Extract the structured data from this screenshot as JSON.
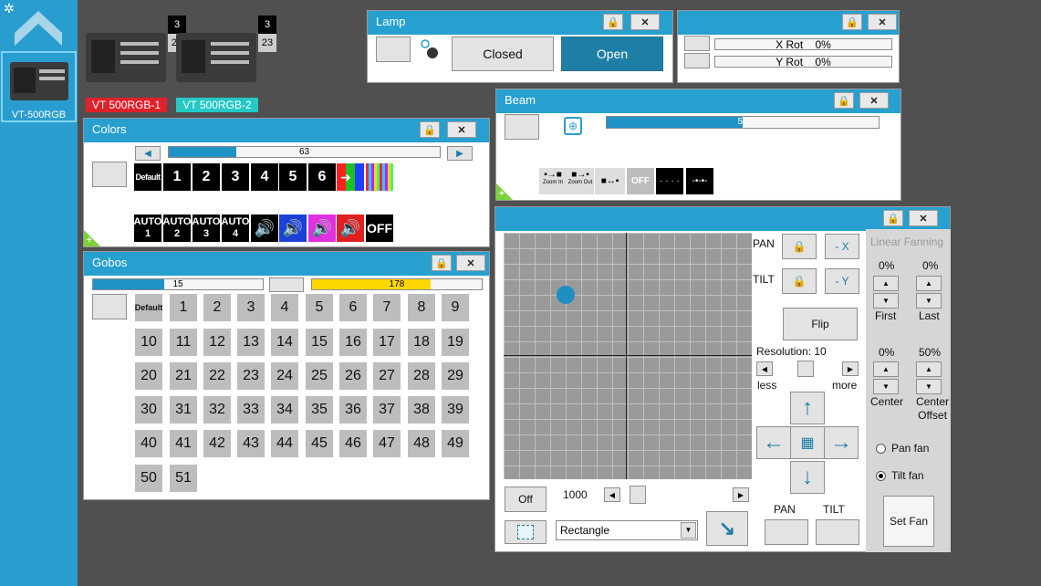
{
  "sidebar": {
    "device_label": "VT-500RGB"
  },
  "devices": [
    {
      "label": "VT 500RGB-1",
      "color": "#e0202a",
      "badge_top": "3",
      "badge_bottom": "23"
    },
    {
      "label": "VT 500RGB-2",
      "color": "#25c9c6",
      "badge_top": "3",
      "badge_bottom": "23"
    }
  ],
  "lamp": {
    "title": "Lamp",
    "closed_label": "Closed",
    "open_label": "Open"
  },
  "rot": {
    "x_label": "X Rot",
    "x_value": "0%",
    "y_label": "Y Rot",
    "y_value": "0%"
  },
  "beam": {
    "title": "Beam",
    "slider_value": "50",
    "slider_fraction": 0.5,
    "zoom_in": "Zoom In",
    "zoom_out": "Zoom Out",
    "off_label": "OFF"
  },
  "colors": {
    "title": "Colors",
    "slider_value": "63",
    "slider_fraction": 0.25,
    "default_label": "Default",
    "numbers": [
      "1",
      "2",
      "3",
      "4",
      "5",
      "6"
    ],
    "auto_top": "AUTO",
    "autos": [
      "1",
      "2",
      "3",
      "4"
    ],
    "off_label": "OFF"
  },
  "gobos": {
    "title": "Gobos",
    "slider1_value": "15",
    "slider1_fraction": 0.42,
    "slider2_value": "178",
    "slider2_fraction": 0.7,
    "default_label": "Default",
    "rows": [
      [
        "1",
        "2",
        "3",
        "4",
        "5",
        "6",
        "7",
        "8",
        "9"
      ],
      [
        "10",
        "11",
        "12",
        "13",
        "14",
        "15",
        "16",
        "17",
        "18",
        "19"
      ],
      [
        "20",
        "21",
        "22",
        "23",
        "24",
        "25",
        "26",
        "27",
        "28",
        "29"
      ],
      [
        "30",
        "31",
        "32",
        "33",
        "34",
        "35",
        "36",
        "37",
        "38",
        "39"
      ],
      [
        "40",
        "41",
        "42",
        "43",
        "44",
        "45",
        "46",
        "47",
        "48",
        "49"
      ],
      [
        "50",
        "51"
      ]
    ]
  },
  "pantilt": {
    "pan_label": "PAN",
    "tilt_label": "TILT",
    "neg_x": "- X",
    "neg_y": "- Y",
    "flip_label": "Flip",
    "resolution_label": "Resolution: 10",
    "less_label": "less",
    "more_label": "more",
    "off_label": "Off",
    "speed_value": "1000",
    "shape_value": "Rectangle",
    "pan_bottom": "PAN",
    "tilt_bottom": "TILT"
  },
  "fanning": {
    "title": "Linear Fanning",
    "first_value": "0%",
    "last_value": "0%",
    "first_label": "First",
    "last_label": "Last",
    "center_value": "0%",
    "offset_value": "50%",
    "center_label": "Center",
    "center_offset_label": "Center\nOffset",
    "pan_fan_label": "Pan fan",
    "tilt_fan_label": "Tilt fan",
    "set_fan_label": "Set Fan"
  },
  "colors_theme": {
    "accent": "#27a0d0",
    "slider_fill": "#1f93c6",
    "gobo_yellow": "#ffd700"
  }
}
